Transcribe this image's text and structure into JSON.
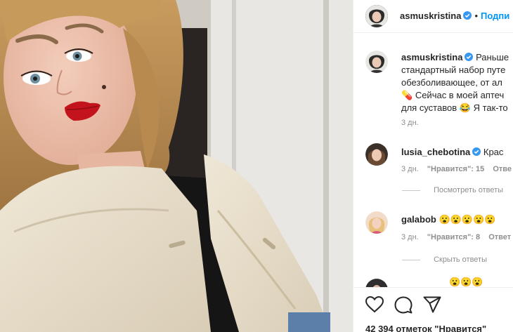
{
  "post": {
    "author": "asmuskristina",
    "follow_label": "Подпи",
    "dot": "•"
  },
  "caption": {
    "author": "asmuskristina",
    "lines": [
      "Раньше",
      "стандартный набор путе",
      "обезболивающее, от ал",
      "Сейчас в моей аптеч",
      "для суставов",
      "Я так-то"
    ],
    "time": "3 дн."
  },
  "comments": [
    {
      "author": "lusia_chebotina",
      "text": "Крас",
      "time": "3 дн.",
      "likes_label": "\"Нравится\": 15",
      "reply_label": "Отве",
      "thread_label": "Посмотреть ответы"
    },
    {
      "author": "galabob",
      "text": "😮😮😮😮😮",
      "time": "3 дн.",
      "likes_label": "\"Нравится\": 8",
      "reply_label": "Ответ",
      "thread_label": "Скрыть ответы"
    },
    {
      "author": "",
      "text": "😮😮😮",
      "partial": true
    }
  ],
  "icons": {
    "like": "heart-icon",
    "comment": "comment-icon",
    "share": "share-icon",
    "verified": "verified-badge-icon"
  },
  "likes_summary": "42 394 отметок \"Нравится\"",
  "colors": {
    "link": "#0095f6",
    "verified": "#3897f0",
    "secondary_text": "#8e8e8e",
    "lips": "#c3131c"
  }
}
